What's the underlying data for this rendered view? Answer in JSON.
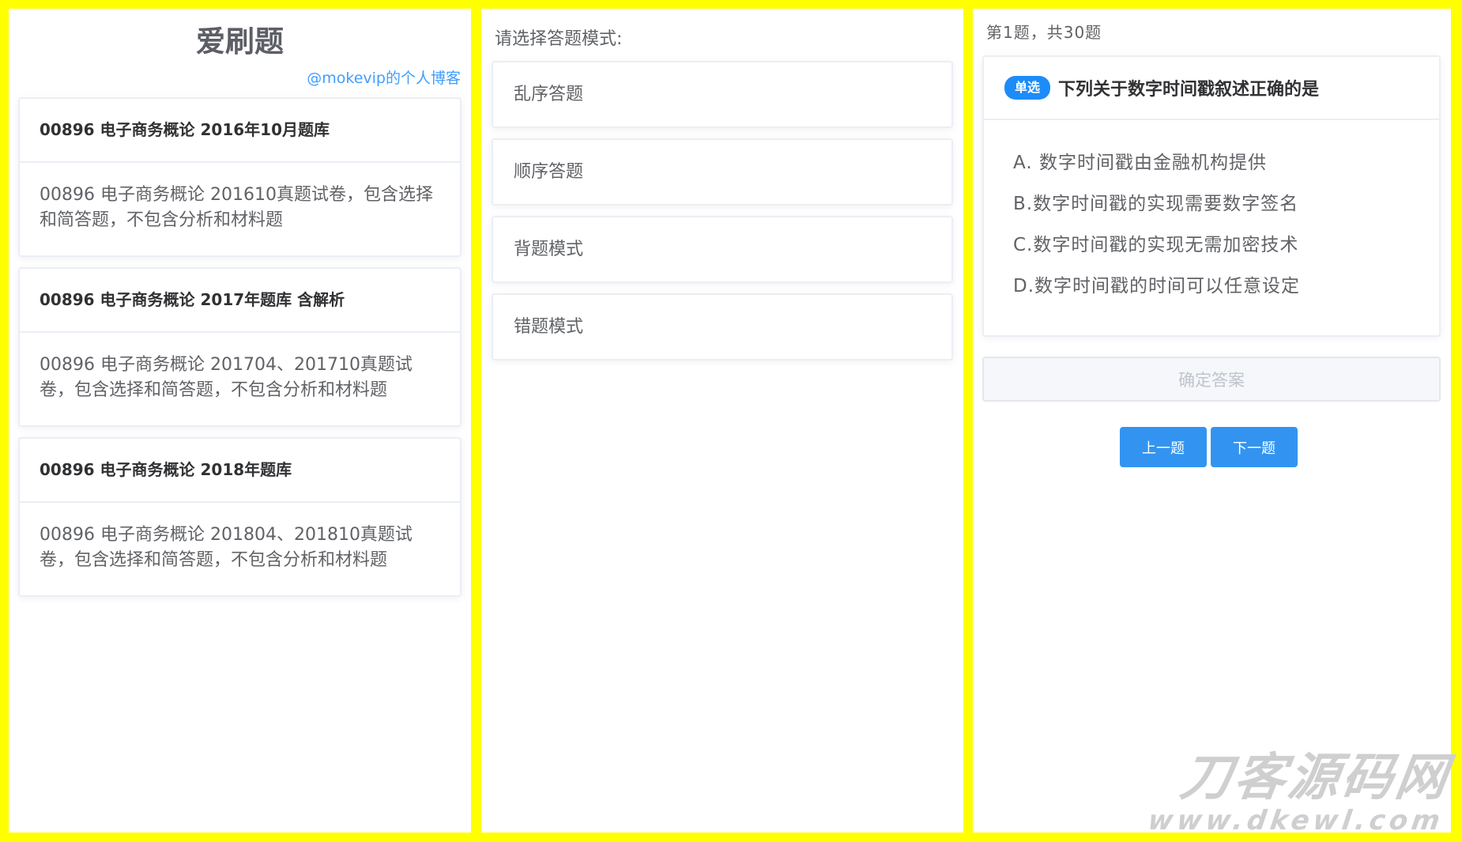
{
  "left_panel": {
    "app_title": "爱刷题",
    "blog_link": "@mokevip的个人博客",
    "banks": [
      {
        "title": "00896 电子商务概论 2016年10月题库",
        "desc": "00896 电子商务概论 201610真题试卷，包含选择和简答题，不包含分析和材料题"
      },
      {
        "title": "00896 电子商务概论 2017年题库 含解析",
        "desc": "00896 电子商务概论 201704、201710真题试卷，包含选择和简答题，不包含分析和材料题"
      },
      {
        "title": "00896 电子商务概论 2018年题库",
        "desc": "00896 电子商务概论 201804、201810真题试卷，包含选择和简答题，不包含分析和材料题"
      }
    ]
  },
  "middle_panel": {
    "label": "请选择答题模式:",
    "modes": [
      "乱序答题",
      "顺序答题",
      "背题模式",
      "错题模式"
    ]
  },
  "right_panel": {
    "progress": "第1题，共30题",
    "question": {
      "type_tag": "单选",
      "title": "下列关于数字时间戳叙述正确的是",
      "options": [
        "A. 数字时间戳由金融机构提供",
        "B.数字时间戳的实现需要数字签名",
        "C.数字时间戳的实现无需加密技术",
        "D.数字时间戳的时间可以任意设定"
      ]
    },
    "confirm_label": "确定答案",
    "prev_label": "上一题",
    "next_label": "下一题"
  },
  "watermark": {
    "text": "刀客源码网",
    "url": "www.dkewl.com"
  },
  "colors": {
    "frame": "#ffff00",
    "accent": "#409eff",
    "button": "#3294f0",
    "tag": "#1d8cf8"
  }
}
